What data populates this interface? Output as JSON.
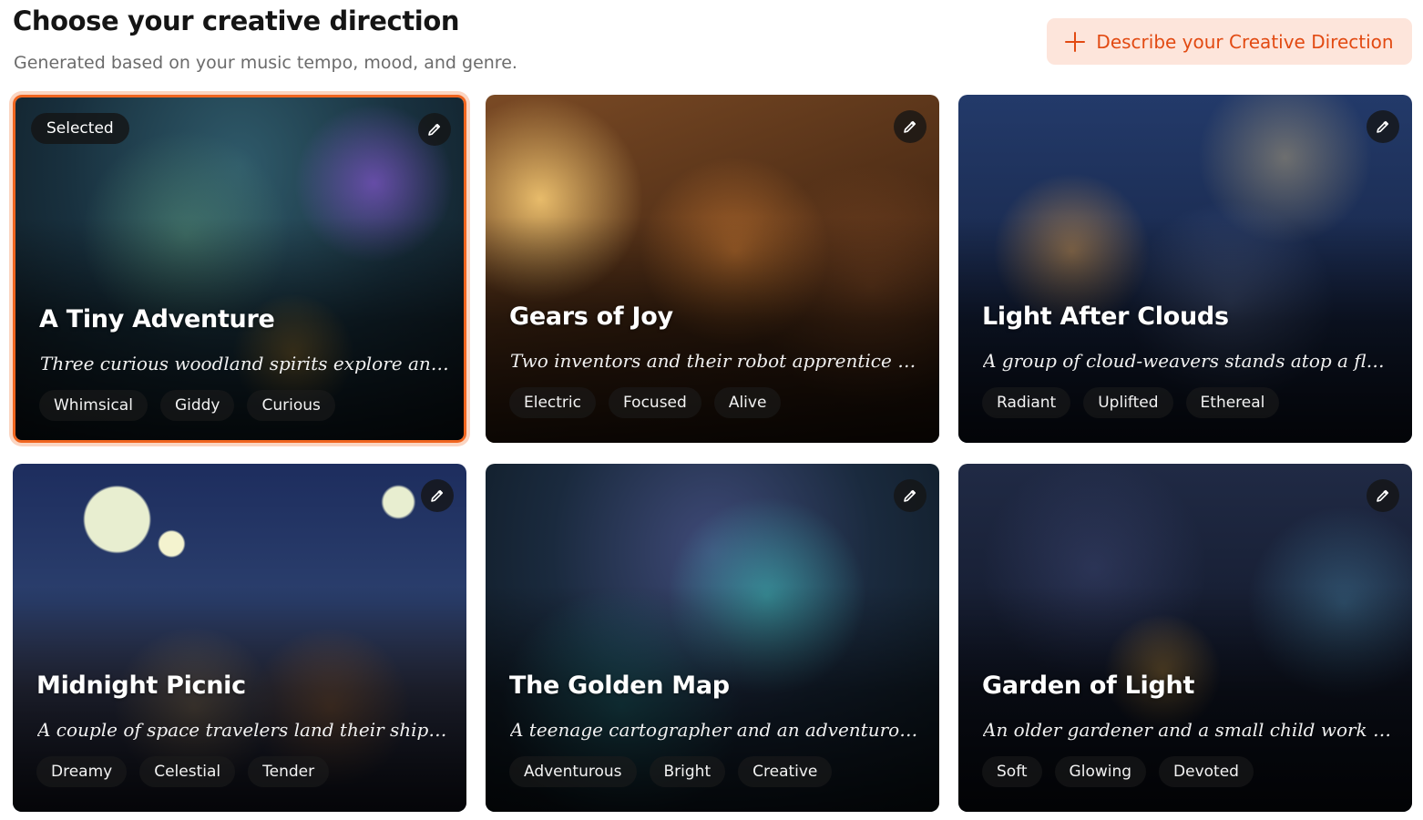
{
  "header": {
    "title": "Choose your creative direction",
    "subtitle": "Generated based on your music tempo, mood, and genre.",
    "describe_button": "Describe your Creative Direction"
  },
  "accent_color": "#f0651f",
  "cards": [
    {
      "title": "A Tiny Adventure",
      "description": "Three curious woodland spirits explore an o…",
      "tags": [
        "Whimsical",
        "Giddy",
        "Curious"
      ],
      "selected": true,
      "selected_label": "Selected"
    },
    {
      "title": "Gears of Joy",
      "description": "Two inventors and their robot apprentice fr…",
      "tags": [
        "Electric",
        "Focused",
        "Alive"
      ],
      "selected": false
    },
    {
      "title": "Light After Clouds",
      "description": "A group of cloud-weavers stands atop a flo…",
      "tags": [
        "Radiant",
        "Uplifted",
        "Ethereal"
      ],
      "selected": false
    },
    {
      "title": "Midnight Picnic",
      "description": "A couple of space travelers land their ship i…",
      "tags": [
        "Dreamy",
        "Celestial",
        "Tender"
      ],
      "selected": false
    },
    {
      "title": "The Golden Map",
      "description": "A teenage cartographer and an adventuro…",
      "tags": [
        "Adventurous",
        "Bright",
        "Creative"
      ],
      "selected": false
    },
    {
      "title": "Garden of Light",
      "description": "An older gardener and a small child work t…",
      "tags": [
        "Soft",
        "Glowing",
        "Devoted"
      ],
      "selected": false
    }
  ]
}
